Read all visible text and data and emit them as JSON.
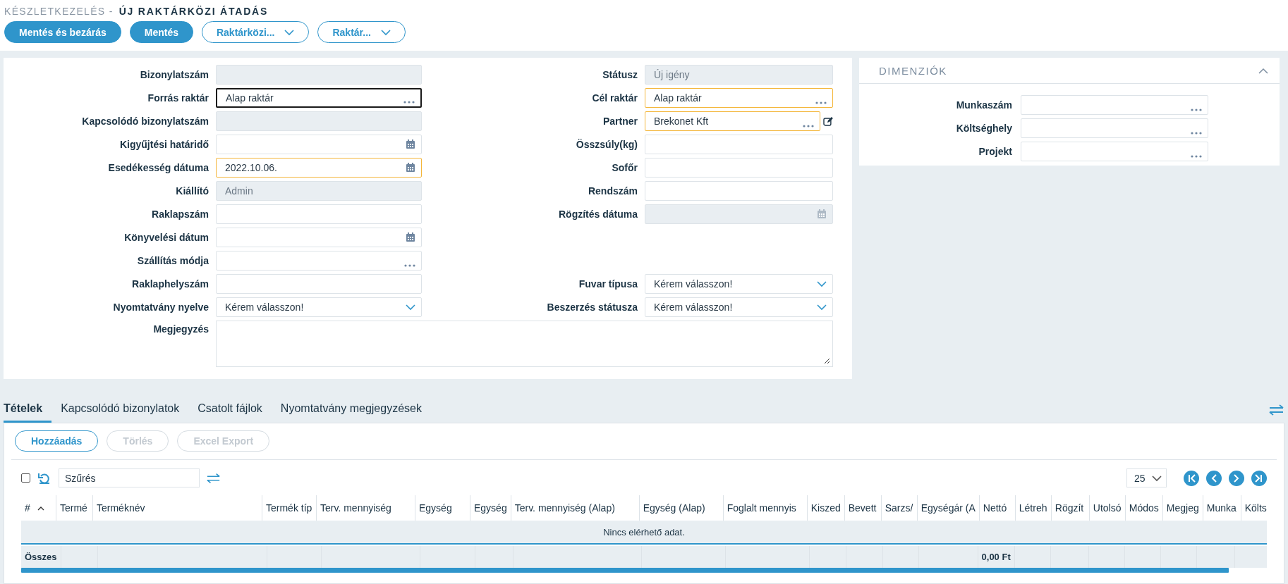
{
  "breadcrumb": {
    "section": "KÉSZLETKEZELÉS -",
    "title": "ÚJ RAKTÁRKÖZI ÁTADÁS"
  },
  "toolbar": [
    {
      "label": "Mentés és bezárás",
      "kind": "primary"
    },
    {
      "label": "Mentés",
      "kind": "primary"
    },
    {
      "label": "Raktárközi...",
      "kind": "dropdown"
    },
    {
      "label": "Raktár...",
      "kind": "dropdown"
    }
  ],
  "form": {
    "rows": [
      {
        "left": {
          "label": "Bizonylatszám",
          "kind": "text",
          "disabled": true
        },
        "right": {
          "label": "Státusz",
          "kind": "text",
          "value": "Új igény",
          "disabled": true
        }
      },
      {
        "left": {
          "label": "Forrás raktár",
          "kind": "lookup",
          "value": "Alap raktár",
          "focused": true
        },
        "right": {
          "label": "Cél raktár",
          "kind": "lookup",
          "value": "Alap raktár",
          "required": true
        }
      },
      {
        "left": {
          "label": "Kapcsolódó bizonylatszám",
          "kind": "text",
          "disabled": true
        },
        "right": {
          "label": "Partner",
          "kind": "lookup",
          "value": "Brekonet Kft",
          "required": true,
          "edit_action": true
        }
      },
      {
        "left": {
          "label": "Kigyűjtési határidő",
          "kind": "date"
        },
        "right": {
          "label": "Összsúly(kg)",
          "kind": "text"
        }
      },
      {
        "left": {
          "label": "Esedékesség dátuma",
          "kind": "date",
          "value": "2022.10.06.",
          "required": true
        },
        "right": {
          "label": "Sofőr",
          "kind": "text"
        }
      },
      {
        "left": {
          "label": "Kiállító",
          "kind": "text",
          "value": "Admin",
          "disabled": true
        },
        "right": {
          "label": "Rendszám",
          "kind": "text"
        }
      },
      {
        "left": {
          "label": "Raklapszám",
          "kind": "text"
        },
        "right": {
          "label": "Rögzítés dátuma",
          "kind": "date",
          "disabled": true
        }
      },
      {
        "left": {
          "label": "Könyvelési dátum",
          "kind": "date"
        }
      },
      {
        "left": {
          "label": "Szállítás módja",
          "kind": "lookup"
        }
      },
      {
        "left": {
          "label": "Raklaphelyszám",
          "kind": "text"
        },
        "right": {
          "label": "Fuvar típusa",
          "kind": "select",
          "value": "Kérem válasszon!"
        }
      },
      {
        "left": {
          "label": "Nyomtatvány nyelve",
          "kind": "select",
          "value": "Kérem válasszon!"
        },
        "right": {
          "label": "Beszerzés státusza",
          "kind": "select",
          "value": "Kérem válasszon!"
        }
      }
    ],
    "note": {
      "label": "Megjegyzés"
    }
  },
  "dimensions": {
    "title": "DIMENZIÓK",
    "expanded": true,
    "fields": [
      {
        "label": "Munkaszám",
        "kind": "lookup"
      },
      {
        "label": "Költséghely",
        "kind": "lookup"
      },
      {
        "label": "Projekt",
        "kind": "lookup"
      }
    ]
  },
  "tabs": [
    {
      "label": "Tételek",
      "selected": true
    },
    {
      "label": "Kapcsolódó bizonylatok",
      "selected": false
    },
    {
      "label": "Csatolt fájlok",
      "selected": false
    },
    {
      "label": "Nyomtatvány megjegyzések",
      "selected": false
    }
  ],
  "grid": {
    "actions": [
      {
        "label": "Hozzáadás",
        "disabled": false
      },
      {
        "label": "Törlés",
        "disabled": true
      },
      {
        "label": "Excel Export",
        "disabled": true
      }
    ],
    "select_all": {
      "checked": false
    },
    "filter": {
      "placeholder": "Szűrés"
    },
    "page_size": "25",
    "columns": [
      "#",
      "Termé",
      "Terméknév",
      "Termék típ",
      "Terv. mennyiség",
      "Egység",
      "Egység",
      "Terv. mennyiség (Alap)",
      "Egység (Alap)",
      "Foglalt mennyis",
      "Kiszed",
      "Bevett",
      "Sarzs/",
      "Egységár (A",
      "Nettó",
      "Létreh",
      "Rögzít",
      "Utolsó",
      "Módos",
      "Megjeg",
      "Munka",
      "Költs"
    ],
    "empty_message": "Nincs elérhető adat.",
    "footer": {
      "total_label": "Összes",
      "net_total": "0,00 Ft"
    }
  }
}
